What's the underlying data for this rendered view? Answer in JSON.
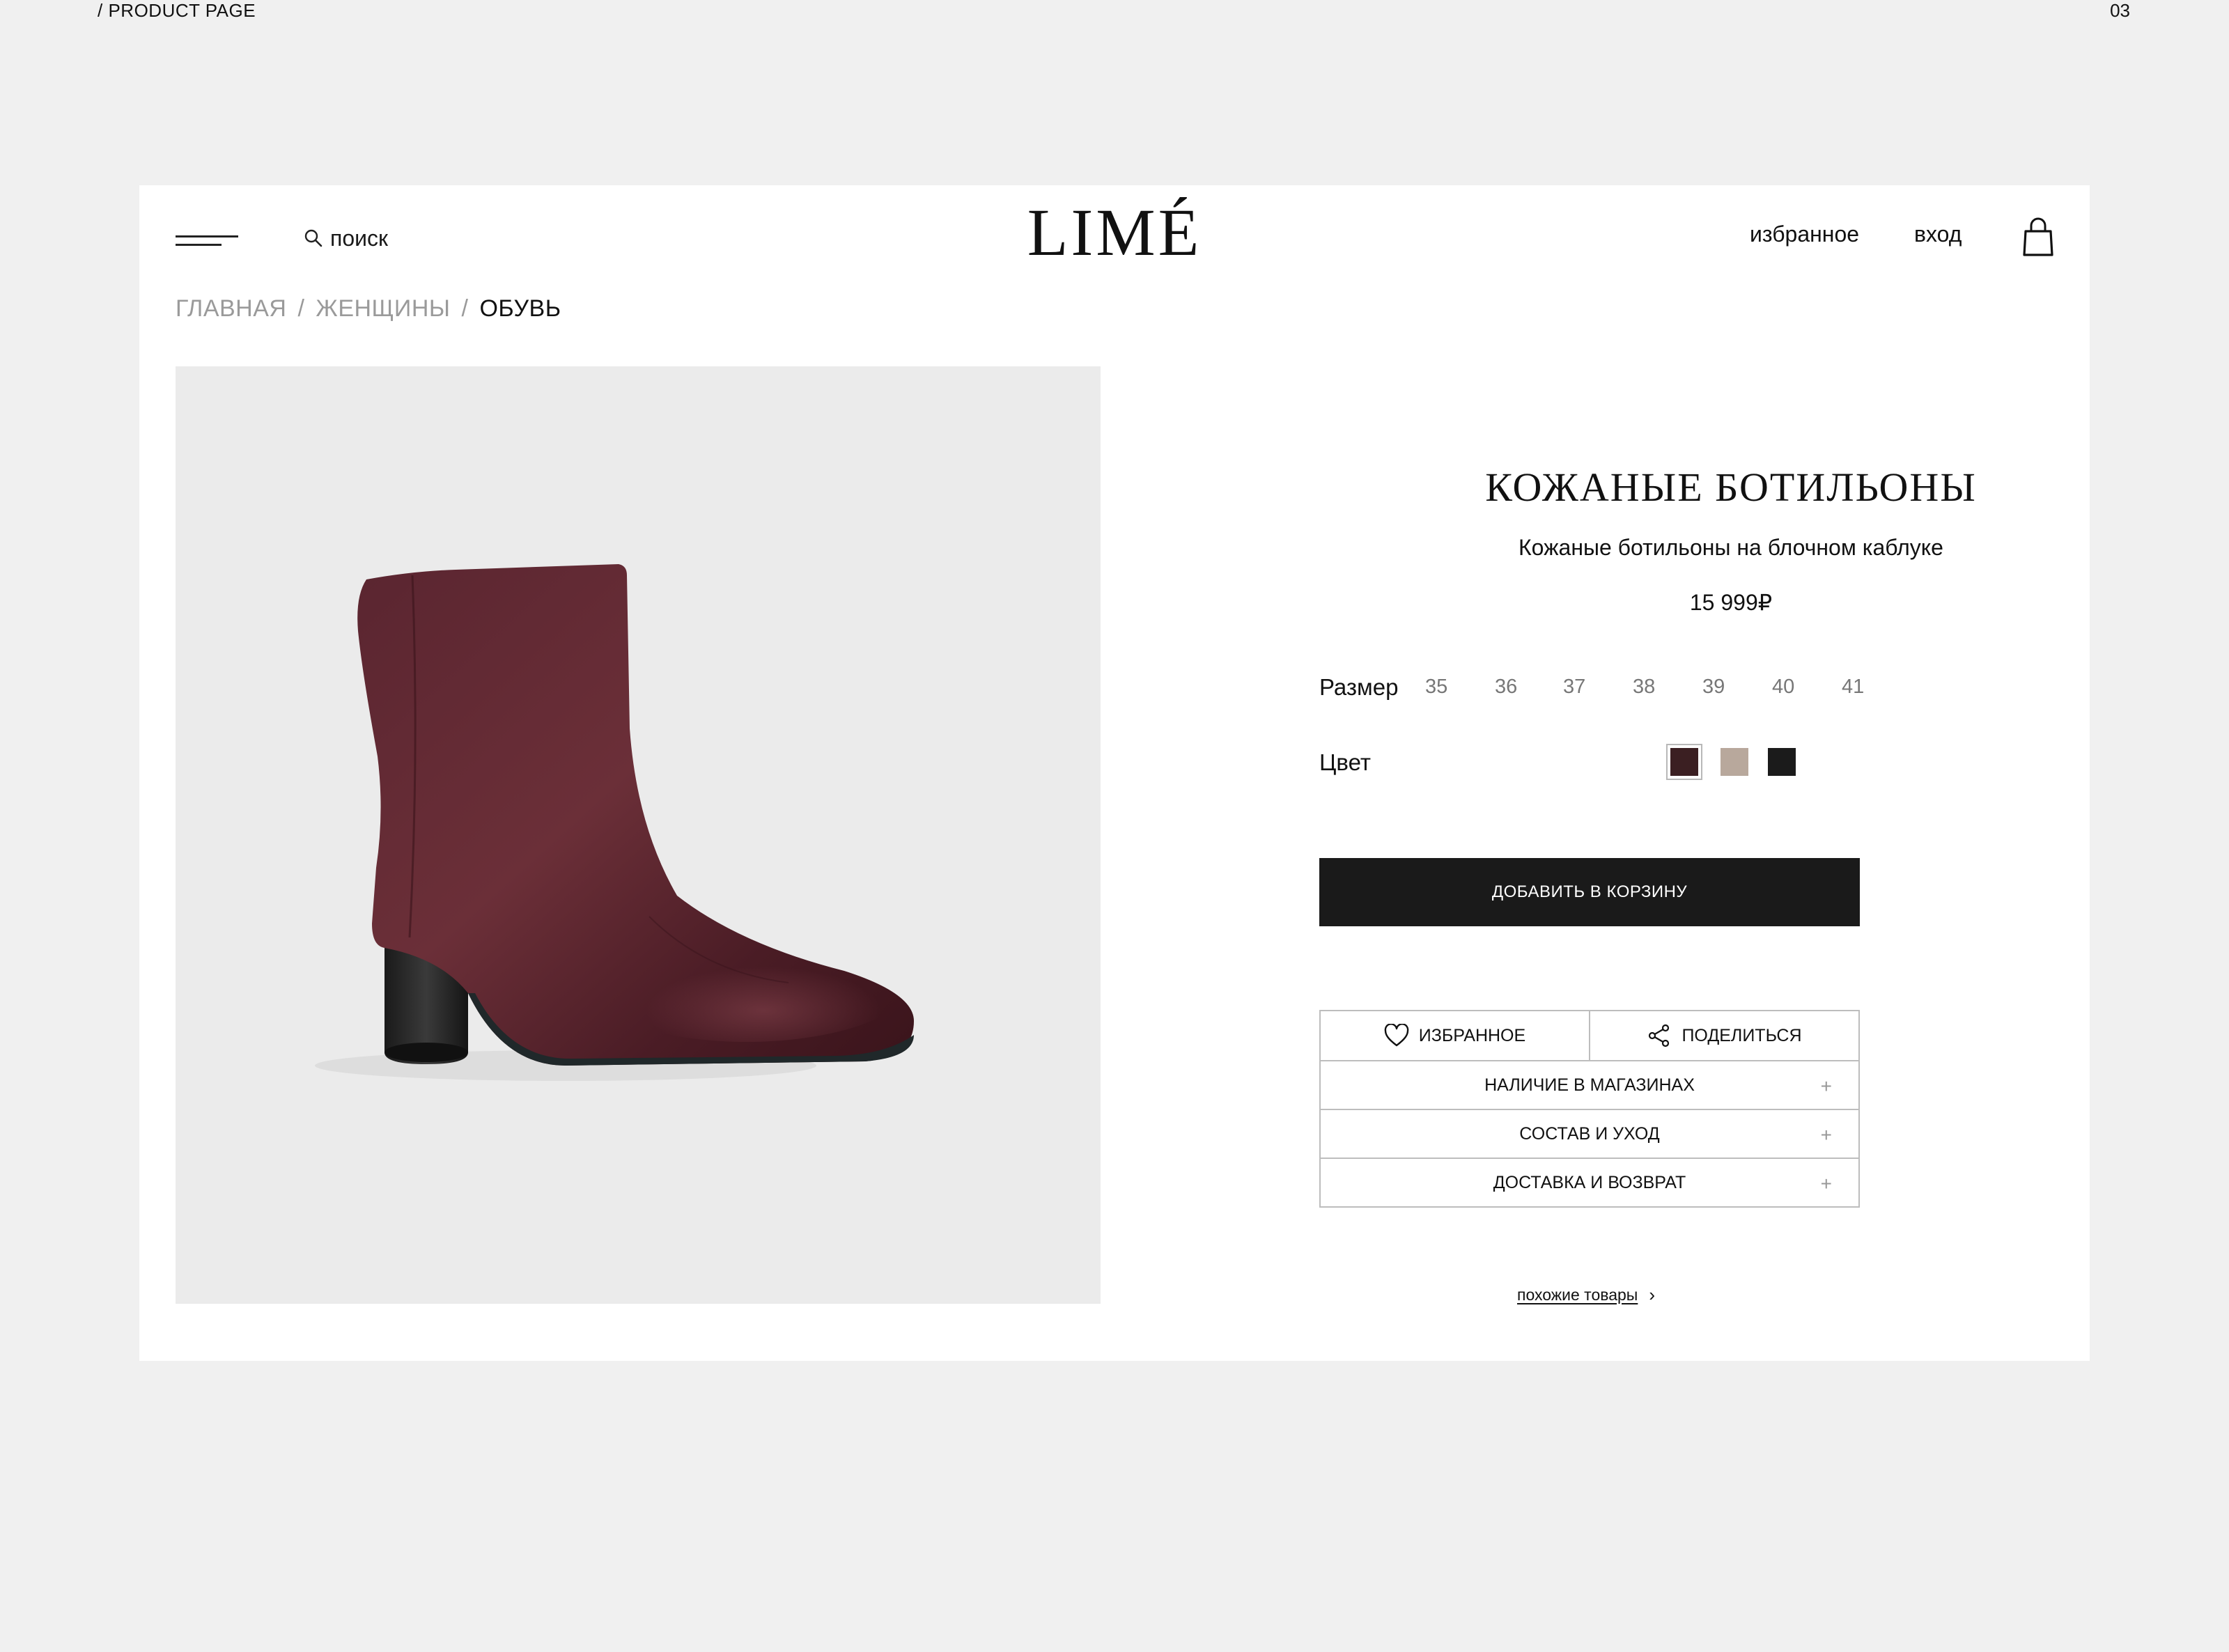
{
  "slide": {
    "label": "/ PRODUCT PAGE",
    "number": "03"
  },
  "header": {
    "search_label": "поиск",
    "logo": "LIMÉ",
    "favorites_label": "избранное",
    "login_label": "вход"
  },
  "breadcrumb": {
    "items": [
      "ГЛАВНАЯ",
      "ЖЕНЩИНЫ",
      "ОБУВЬ"
    ],
    "separator": "/"
  },
  "product": {
    "title": "КОЖАНЫЕ БОТИЛЬОНЫ",
    "subtitle": "Кожаные ботильоны на блочном каблуке",
    "price": "15 999₽",
    "size_label": "Размер",
    "sizes": [
      "35",
      "36",
      "37",
      "38",
      "39",
      "40",
      "41"
    ],
    "color_label": "Цвет",
    "colors": [
      "#3b1f22",
      "#b8a89c",
      "#1b1b1b"
    ],
    "selected_color": "#3b1f22",
    "add_to_cart_label": "ДОБАВИТЬ В КОРЗИНУ",
    "favorite_label": "ИЗБРАННОЕ",
    "share_label": "ПОДЕЛИТЬСЯ",
    "accordion": [
      "НАЛИЧИЕ В МАГАЗИНАХ",
      "СОСТАВ И УХОД",
      "ДОСТАВКА И ВОЗВРАТ"
    ],
    "accordion_icon": "+",
    "similar_label": "похожие товары",
    "similar_icon": "›"
  }
}
